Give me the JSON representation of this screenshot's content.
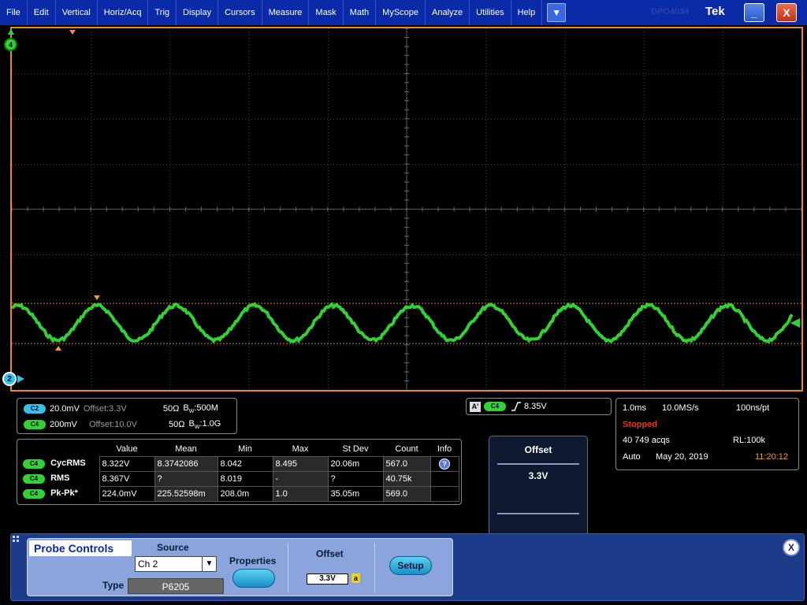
{
  "menu": {
    "items": [
      "File",
      "Edit",
      "Vertical",
      "Horiz/Acq",
      "Trig",
      "Display",
      "Cursors",
      "Measure",
      "Mask",
      "Math",
      "MyScope",
      "Analyze",
      "Utilities",
      "Help"
    ],
    "dropdown_icon": "chevron-down-icon",
    "brand_ghost": "DPO4034",
    "brand": "Tek",
    "minimize_label": "_",
    "close_label": "X"
  },
  "waveform": {
    "channel_marker_c4": "4",
    "channel_marker_c2": "2",
    "color": "#33d233"
  },
  "channels": [
    {
      "badge": "C2",
      "scale": "20.0mV",
      "offset_label": "Offset:3.3V",
      "impedance": "50Ω",
      "bw_prefix": "B",
      "bw_sub": "W",
      "bw_value": ":500M",
      "color": "#33c2e8"
    },
    {
      "badge": "C4",
      "scale": "200mV",
      "offset_label": "Offset:10.0V",
      "impedance": "50Ω",
      "bw_prefix": "B",
      "bw_sub": "W",
      "bw_value": ":1.0G",
      "color": "#33d233"
    }
  ],
  "measurements": {
    "headers": [
      "Value",
      "Mean",
      "Min",
      "Max",
      "St Dev",
      "Count",
      "Info"
    ],
    "rows": [
      {
        "badge": "C4",
        "name": "CycRMS",
        "value": "8.322V",
        "mean": "8.3742086",
        "min": "8.042",
        "max": "8.495",
        "stdev": "20.06m",
        "count": "567.0",
        "info": "?"
      },
      {
        "badge": "C4",
        "name": "RMS",
        "value": "8.367V",
        "mean": "?",
        "min": "8.019",
        "max": "-",
        "stdev": "?",
        "count": "40.75k",
        "info": ""
      },
      {
        "badge": "C4",
        "name": "Pk-Pk*",
        "value": "224.0mV",
        "mean": "225.52598m",
        "min": "208.0m",
        "max": "1.0",
        "stdev": "35.05m",
        "count": "569.0",
        "info": ""
      }
    ]
  },
  "trigger": {
    "label": "A'",
    "badge": "C4",
    "edge_icon": "rising-edge-icon",
    "level": "8.35V"
  },
  "offset_popup": {
    "title": "Offset",
    "value": "3.3V"
  },
  "acquisition": {
    "time_div": "1.0ms",
    "sample_rate": "10.0MS/s",
    "resolution": "100ns/pt",
    "status": "Stopped",
    "acqs": "40 749 acqs",
    "record_length": "RL:100k",
    "mode": "Auto",
    "date": "May 20, 2019",
    "time": "11:20:12"
  },
  "probe_controls": {
    "title": "Probe Controls",
    "source_label": "Source",
    "source_value": "Ch 2",
    "type_label": "Type",
    "type_value": "P6205",
    "properties_label": "Properties",
    "offset_label": "Offset",
    "offset_value": "3.3V",
    "offset_knob": "a",
    "setup_label": "Setup",
    "close_label": "X"
  }
}
